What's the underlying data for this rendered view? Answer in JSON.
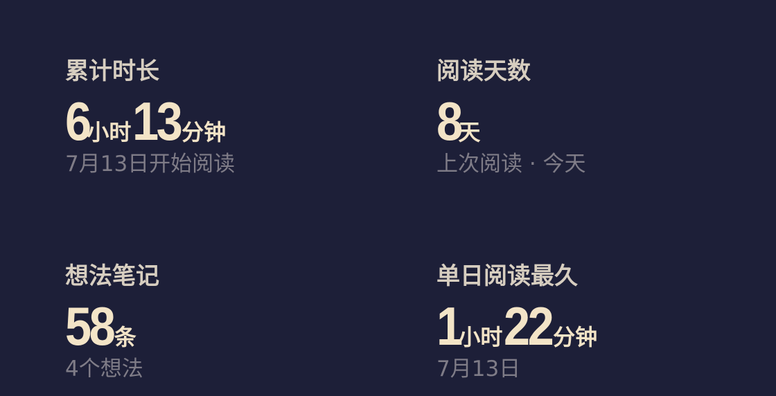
{
  "stats": {
    "total_time": {
      "label": "累计时长",
      "hours": "6",
      "hours_unit": "小时",
      "minutes": "13",
      "minutes_unit": "分钟",
      "sub": "7月13日开始阅读"
    },
    "reading_days": {
      "label": "阅读天数",
      "value": "8",
      "unit": "天",
      "sub": "上次阅读 · 今天"
    },
    "notes": {
      "label": "想法笔记",
      "value": "58",
      "unit": "条",
      "sub": "4个想法"
    },
    "longest_day": {
      "label": "单日阅读最久",
      "hours": "1",
      "hours_unit": "小时",
      "minutes": "22",
      "minutes_unit": "分钟",
      "sub": "7月13日"
    }
  },
  "colors": {
    "background": "#1d1f38",
    "value_text": "#f3e4c7",
    "label_text": "#d7cec0",
    "sub_text": "#7f7c87"
  }
}
